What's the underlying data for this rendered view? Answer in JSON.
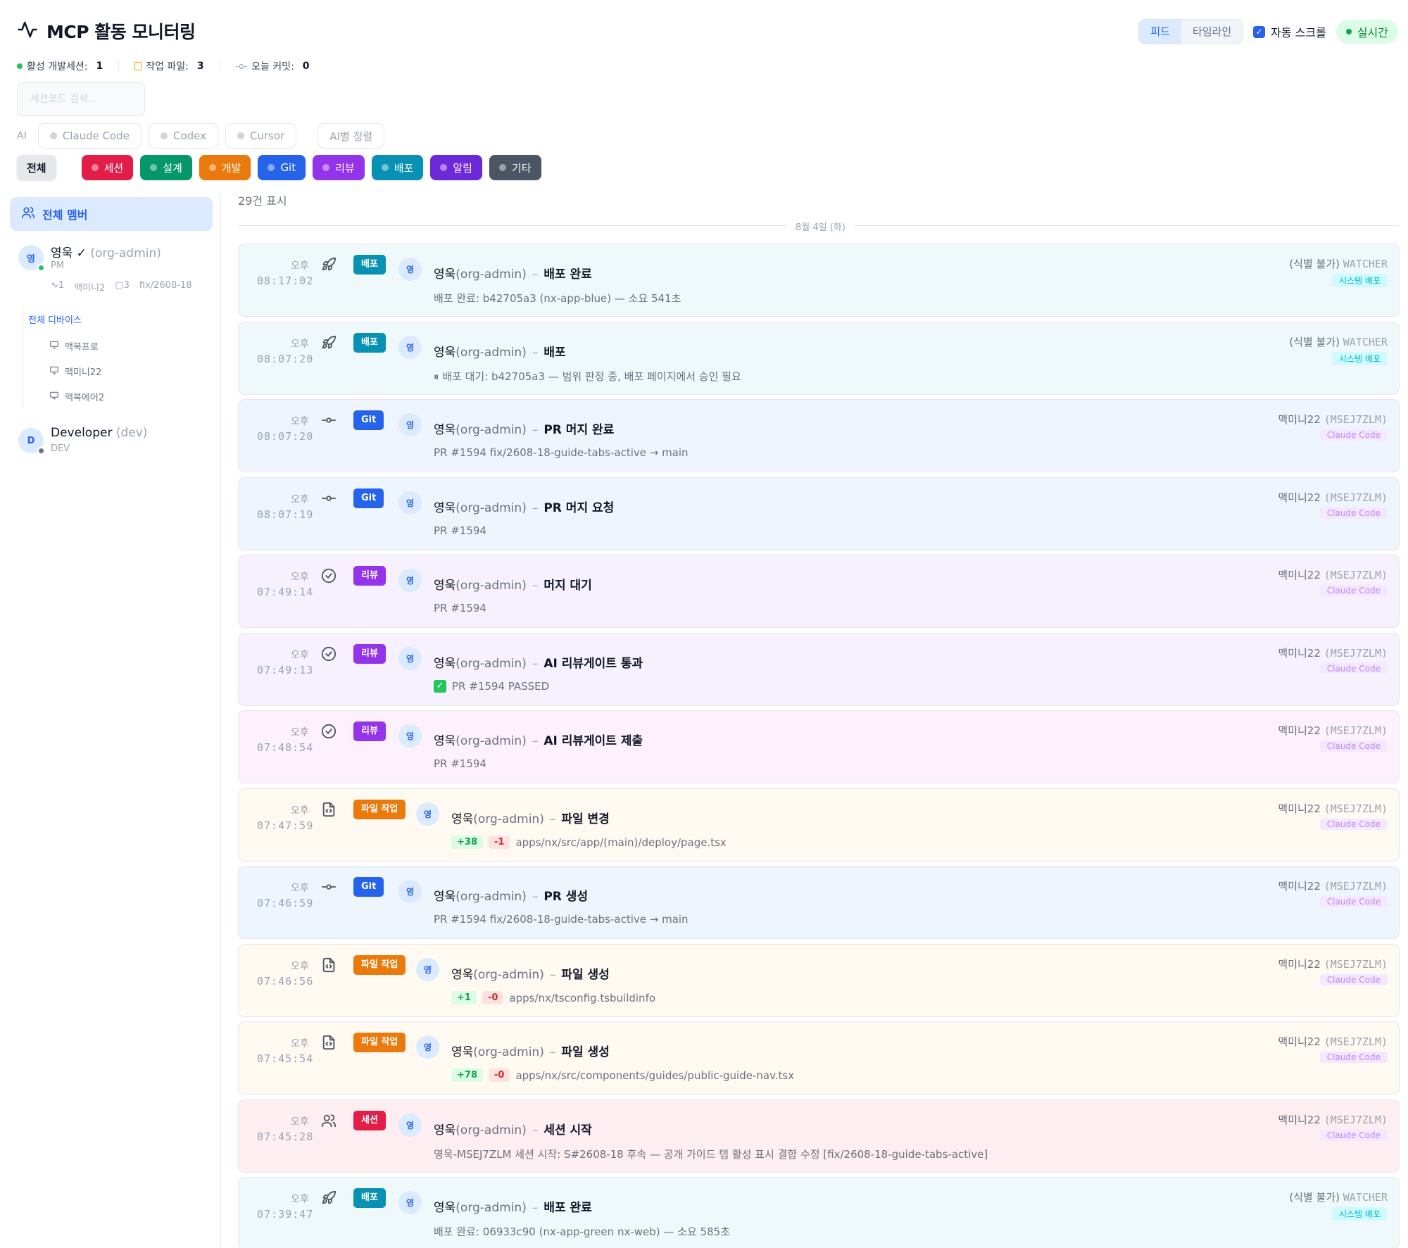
{
  "header": {
    "title": "MCP 활동 모니터링",
    "view_tabs": [
      "피드",
      "타임라인"
    ],
    "autoscroll_label": "자동 스크롤",
    "live_label": "실시간"
  },
  "stats": {
    "active_sessions_label": "활성 개발세션:",
    "active_sessions": "1",
    "work_files_label": "작업 파일:",
    "work_files": "3",
    "commits_label": "오늘 커밋:",
    "commits": "0"
  },
  "search": {
    "placeholder": "세션코드 검색..."
  },
  "ai_filter": {
    "label": "AI",
    "chips": [
      "Claude Code",
      "Codex",
      "Cursor"
    ],
    "sort_label": "AI별 정렬"
  },
  "categories": {
    "all": "전체",
    "items": [
      {
        "label": "세션",
        "color": "#e11d48"
      },
      {
        "label": "설계",
        "color": "#059669"
      },
      {
        "label": "개발",
        "color": "#ea7a0c"
      },
      {
        "label": "Git",
        "color": "#2563eb"
      },
      {
        "label": "리뷰",
        "color": "#9333ea"
      },
      {
        "label": "배포",
        "color": "#0891b2"
      },
      {
        "label": "알림",
        "color": "#6d28d9"
      },
      {
        "label": "기타",
        "color": "#4b5563"
      }
    ]
  },
  "sidebar": {
    "all_members": "전체 멤버",
    "members": [
      {
        "avatar": "영",
        "name": "영욱 ✓",
        "role": "(org-admin)",
        "sub": "PM",
        "meta": [
          "1",
          "맥미니2",
          "3",
          "fix/2608-18"
        ],
        "status_color": "#22c55e"
      },
      {
        "avatar": "D",
        "name": "Developer",
        "role": "(dev)",
        "sub": "DEV",
        "status_color": "#6b7280"
      }
    ],
    "devices_all": "전체 디바이스",
    "devices": [
      "맥북프로",
      "맥미니22",
      "맥북에어2"
    ]
  },
  "feed": {
    "count_label": "29건 표시",
    "date_label": "8월 4일 (화)",
    "events": [
      {
        "ampm": "오후",
        "time": "08:17:02",
        "icon": "rocket-icon",
        "badge": "배포",
        "badge_color": "#0891b2",
        "avatar": "영",
        "user": "영욱",
        "role": "(org-admin)",
        "action": "배포 완료",
        "detail": "배포 완료: b42705a3 (nx-app-blue) — 소요 541초",
        "source": "(식별 불가)",
        "source_id": "WATCHER",
        "tag": "시스템 배포",
        "tag_kind": "sys",
        "bg": "#eff8fa"
      },
      {
        "ampm": "오후",
        "time": "08:07:20",
        "icon": "rocket-icon",
        "badge": "배포",
        "badge_color": "#0891b2",
        "avatar": "영",
        "user": "영욱",
        "role": "(org-admin)",
        "action": "배포",
        "detail": "⏸ 배포 대기: b42705a3 — 범위 판정 중, 배포 페이지에서 승인 필요",
        "source": "(식별 불가)",
        "source_id": "WATCHER",
        "tag": "시스템 배포",
        "tag_kind": "sys",
        "bg": "#eff8fa"
      },
      {
        "ampm": "오후",
        "time": "08:07:20",
        "icon": "commit-icon",
        "badge": "Git",
        "badge_color": "#2563eb",
        "avatar": "영",
        "user": "영욱",
        "role": "(org-admin)",
        "action": "PR 머지 완료",
        "detail": "PR #1594 fix/2608-18-guide-tabs-active → main",
        "source": "맥미니22",
        "source_id": "(MSEJ7ZLM)",
        "tag": "Claude Code",
        "tag_kind": "cc",
        "bg": "#eff5fc"
      },
      {
        "ampm": "오후",
        "time": "08:07:19",
        "icon": "commit-icon",
        "badge": "Git",
        "badge_color": "#2563eb",
        "avatar": "영",
        "user": "영욱",
        "role": "(org-admin)",
        "action": "PR 머지 요청",
        "detail": "PR #1594",
        "source": "맥미니22",
        "source_id": "(MSEJ7ZLM)",
        "tag": "Claude Code",
        "tag_kind": "cc",
        "bg": "#eff5fc"
      },
      {
        "ampm": "오후",
        "time": "07:49:14",
        "icon": "check-circle-icon",
        "badge": "리뷰",
        "badge_color": "#9333ea",
        "avatar": "영",
        "user": "영욱",
        "role": "(org-admin)",
        "action": "머지 대기",
        "detail": "PR #1594",
        "source": "맥미니22",
        "source_id": "(MSEJ7ZLM)",
        "tag": "Claude Code",
        "tag_kind": "cc",
        "bg": "#f6f1fd"
      },
      {
        "ampm": "오후",
        "time": "07:49:13",
        "icon": "check-circle-icon",
        "badge": "리뷰",
        "badge_color": "#9333ea",
        "avatar": "영",
        "user": "영욱",
        "role": "(org-admin)",
        "action": "AI 리뷰게이트 통과",
        "detail": "PR #1594 PASSED",
        "detail_check": true,
        "source": "맥미니22",
        "source_id": "(MSEJ7ZLM)",
        "tag": "Claude Code",
        "tag_kind": "cc",
        "bg": "#f6f1fd"
      },
      {
        "ampm": "오후",
        "time": "07:48:54",
        "icon": "check-circle-icon",
        "badge": "리뷰",
        "badge_color": "#9333ea",
        "avatar": "영",
        "user": "영욱",
        "role": "(org-admin)",
        "action": "AI 리뷰게이트 제출",
        "detail": "PR #1594",
        "source": "맥미니22",
        "source_id": "(MSEJ7ZLM)",
        "tag": "Claude Code",
        "tag_kind": "cc",
        "bg": "#fcf1fd"
      },
      {
        "ampm": "오후",
        "time": "07:47:59",
        "icon": "file-code-icon",
        "badge": "파일 작업",
        "badge_color": "#ea7a0c",
        "avatar": "영",
        "user": "영욱",
        "role": "(org-admin)",
        "action": "파일 변경",
        "add": "+38",
        "del": "-1",
        "detail": "apps/nx/src/app/(main)/deploy/page.tsx",
        "source": "맥미니22",
        "source_id": "(MSEJ7ZLM)",
        "tag": "Claude Code",
        "tag_kind": "cc",
        "bg": "#fef9f1"
      },
      {
        "ampm": "오후",
        "time": "07:46:59",
        "icon": "commit-icon",
        "badge": "Git",
        "badge_color": "#2563eb",
        "avatar": "영",
        "user": "영욱",
        "role": "(org-admin)",
        "action": "PR 생성",
        "detail": "PR #1594 fix/2608-18-guide-tabs-active → main",
        "source": "맥미니22",
        "source_id": "(MSEJ7ZLM)",
        "tag": "Claude Code",
        "tag_kind": "cc",
        "bg": "#eff5fc"
      },
      {
        "ampm": "오후",
        "time": "07:46:56",
        "icon": "file-code-icon",
        "badge": "파일 작업",
        "badge_color": "#ea7a0c",
        "avatar": "영",
        "user": "영욱",
        "role": "(org-admin)",
        "action": "파일 생성",
        "add": "+1",
        "del": "-0",
        "detail": "apps/nx/tsconfig.tsbuildinfo",
        "source": "맥미니22",
        "source_id": "(MSEJ7ZLM)",
        "tag": "Claude Code",
        "tag_kind": "cc",
        "bg": "#fef9f1"
      },
      {
        "ampm": "오후",
        "time": "07:45:54",
        "icon": "file-code-icon",
        "badge": "파일 작업",
        "badge_color": "#ea7a0c",
        "avatar": "영",
        "user": "영욱",
        "role": "(org-admin)",
        "action": "파일 생성",
        "add": "+78",
        "del": "-0",
        "detail": "apps/nx/src/components/guides/public-guide-nav.tsx",
        "source": "맥미니22",
        "source_id": "(MSEJ7ZLM)",
        "tag": "Claude Code",
        "tag_kind": "cc",
        "bg": "#fef9f1"
      },
      {
        "ampm": "오후",
        "time": "07:45:28",
        "icon": "users-icon",
        "badge": "세션",
        "badge_color": "#e11d48",
        "avatar": "영",
        "user": "영욱",
        "role": "(org-admin)",
        "action": "세션 시작",
        "detail": "영욱-MSEJ7ZLM 세션 시작: S#2608-18 후속 — 공개 가이드 탭 활성 표시 결함 수정 [fix/2608-18-guide-tabs-active]",
        "source": "맥미니22",
        "source_id": "(MSEJ7ZLM)",
        "tag": "Claude Code",
        "tag_kind": "cc",
        "bg": "#fdeef1"
      },
      {
        "ampm": "오후",
        "time": "07:39:47",
        "icon": "rocket-icon",
        "badge": "배포",
        "badge_color": "#0891b2",
        "avatar": "영",
        "user": "영욱",
        "role": "(org-admin)",
        "action": "배포 완료",
        "detail": "배포 완료: 06933c90 (nx-app-green nx-web) — 소요 585초",
        "source": "(식별 불가)",
        "source_id": "WATCHER",
        "tag": "시스템 배포",
        "tag_kind": "sys",
        "bg": "#eff8fa"
      }
    ]
  }
}
